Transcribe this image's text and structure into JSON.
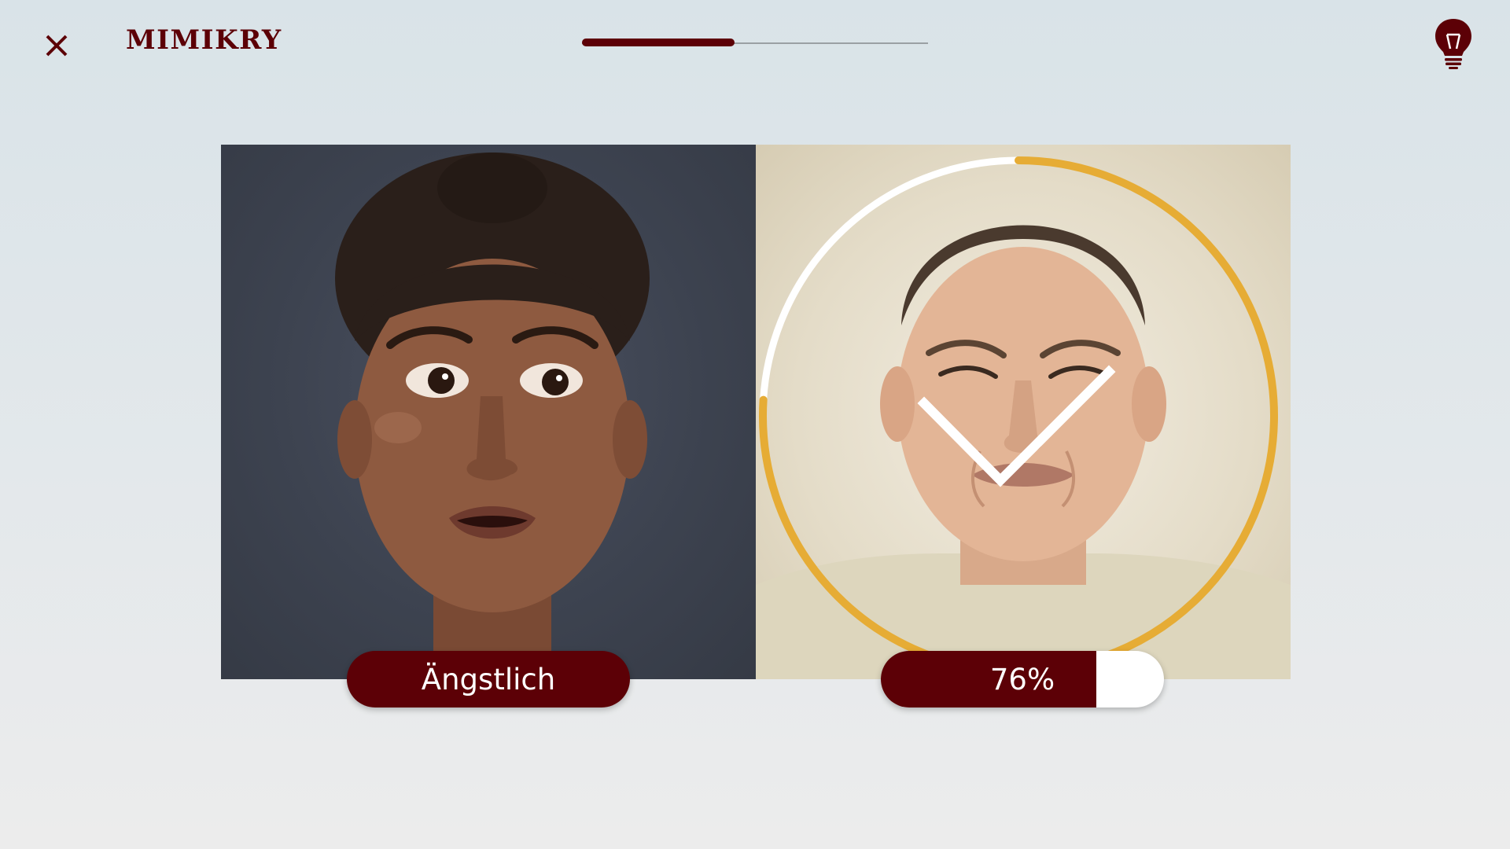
{
  "header": {
    "app_title": "MIMIKRY",
    "close_icon": "close-icon",
    "hint_icon": "lightbulb-icon",
    "progress": 0.44
  },
  "exercise": {
    "target_emotion": "Ängstlich",
    "match_score": 0.76,
    "match_label": "76%",
    "result_icon": "checkmark-icon"
  },
  "colors": {
    "brand": "#5c0006",
    "ring": "#e6ac35",
    "ring_track": "#ffffff",
    "background": "#dde5ea"
  }
}
